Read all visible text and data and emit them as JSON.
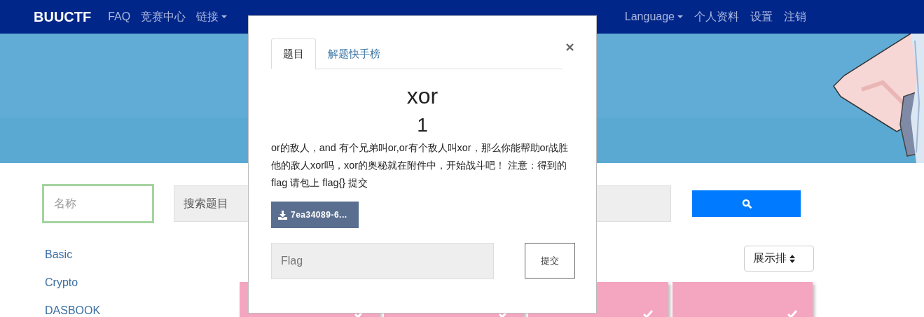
{
  "navbar": {
    "brand": "BUUCTF",
    "left_items": [
      {
        "label": "FAQ",
        "dropdown": false
      },
      {
        "label": "竞赛中心",
        "dropdown": false
      },
      {
        "label": "链接",
        "dropdown": true
      }
    ],
    "right_items": [
      {
        "label": "Language",
        "dropdown": true
      },
      {
        "label": "个人资料",
        "dropdown": false
      },
      {
        "label": "设置",
        "dropdown": false
      },
      {
        "label": "注销",
        "dropdown": false
      }
    ]
  },
  "filters": {
    "name_placeholder": "名称",
    "search_placeholder": "搜索题目"
  },
  "categories": [
    "Basic",
    "Crypto",
    "DASBOOK"
  ],
  "sort": {
    "label": "展示排"
  },
  "cards": [
    {
      "solved": true
    },
    {
      "solved": true
    },
    {
      "solved": true
    },
    {
      "solved": true
    }
  ],
  "modal": {
    "tabs": [
      {
        "label": "题目",
        "selected": true
      },
      {
        "label": "解题快手榜",
        "selected": false
      }
    ],
    "title": "xor",
    "points": "1",
    "description": "or的敌人，and 有个兄弟叫or,or有个敌人叫xor，那么你能帮助or战胜他的敌人xor吗，xor的奥秘就在附件中，开始战斗吧！ 注意：得到的 flag 请包上 flag{} 提交",
    "attachment": "7ea34089-6...",
    "flag_placeholder": "Flag",
    "submit": "提交"
  }
}
